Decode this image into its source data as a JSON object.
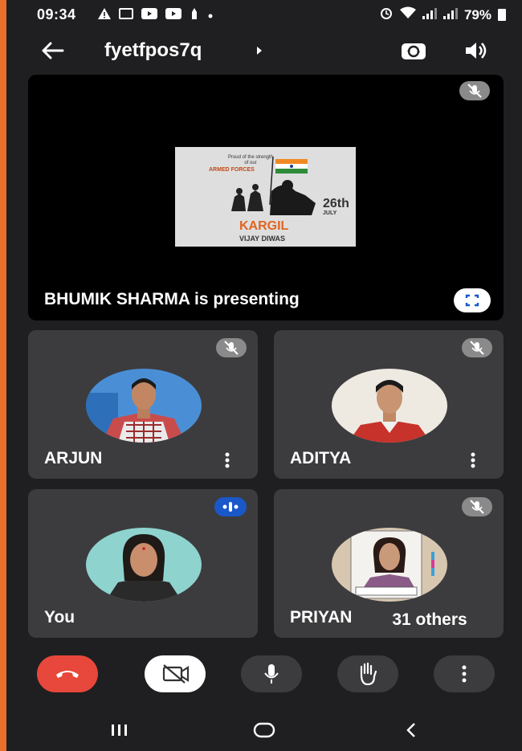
{
  "status_bar": {
    "time": "09:34",
    "battery": "79%"
  },
  "header": {
    "meeting_code": "fyetfpos7q"
  },
  "presentation": {
    "poster": {
      "line1": "Proud of the strength of our",
      "line2": "ARMED FORCES",
      "date": "26th",
      "month": "JULY",
      "title": "KARGIL",
      "subtitle": "VIJAY DIWAS"
    },
    "label": "BHUMIK SHARMA is presenting"
  },
  "participants": [
    {
      "name": "ARJUN"
    },
    {
      "name": "ADITYA"
    },
    {
      "name": "You"
    },
    {
      "name": "PRIYANKA SHARMA",
      "visible_name": "PRIYAN"
    }
  ],
  "others_badge": "31 others",
  "colors": {
    "end_call": "#e8473b",
    "speaking": "#1a58c9",
    "tile": "#3c3c3e",
    "background": "#1f1f21"
  },
  "icons": [
    "back-arrow-icon",
    "switch-camera-icon",
    "speaker-icon",
    "mic-off-icon",
    "fullscreen-icon",
    "more-vert-icon",
    "speaking-indicator-icon",
    "end-call-icon",
    "camera-off-icon",
    "mic-icon",
    "raise-hand-icon",
    "recents-icon",
    "home-icon",
    "back-nav-icon"
  ]
}
